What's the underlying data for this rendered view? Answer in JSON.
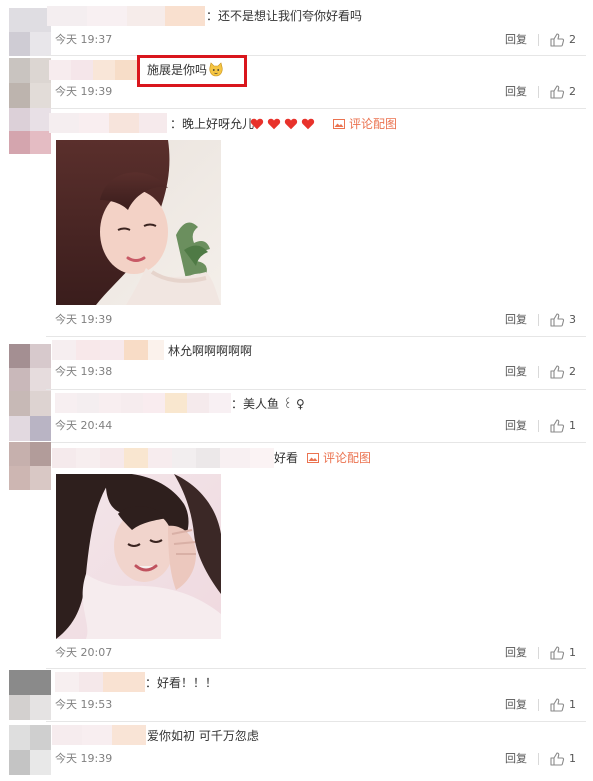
{
  "comments": [
    {
      "text": "：还不是想让我们夸你好看吗",
      "time": "今天 19:37",
      "reply_label": "回复",
      "likes": "2"
    },
    {
      "text": "施展是你吗",
      "emoji": "cat-face-emoji",
      "time": "今天 19:39",
      "reply_label": "回复",
      "likes": "2",
      "highlight_color": "#d9161c"
    },
    {
      "text": "：晚上好呀允儿",
      "hearts": [
        "heart-icon",
        "heart-icon",
        "heart-icon",
        "heart-icon"
      ],
      "image_link_label": "评论配图",
      "time": "今天 19:39",
      "reply_label": "回复",
      "likes": "3"
    },
    {
      "text": "林允啊啊啊啊啊",
      "time": "今天 19:38",
      "reply_label": "回复",
      "likes": "2"
    },
    {
      "text": "：美人鱼 ꒰ ♀",
      "time": "今天 20:44",
      "reply_label": "回复",
      "likes": "1"
    },
    {
      "text": "好看",
      "image_link_label": "评论配图",
      "time": "今天 20:07",
      "reply_label": "回复",
      "likes": "1"
    },
    {
      "text": "：好看！！！",
      "time": "今天 19:53",
      "reply_label": "回复",
      "likes": "1"
    },
    {
      "text": "爱你如初 可千万忽虑",
      "time": "今天 19:39",
      "reply_label": "回复",
      "likes": "1"
    }
  ],
  "colors": {
    "accent": "#eb7350",
    "highlight": "#d9161c",
    "heart": "#e8322b",
    "divider": "#e6e6e6",
    "time_text": "#808080"
  }
}
